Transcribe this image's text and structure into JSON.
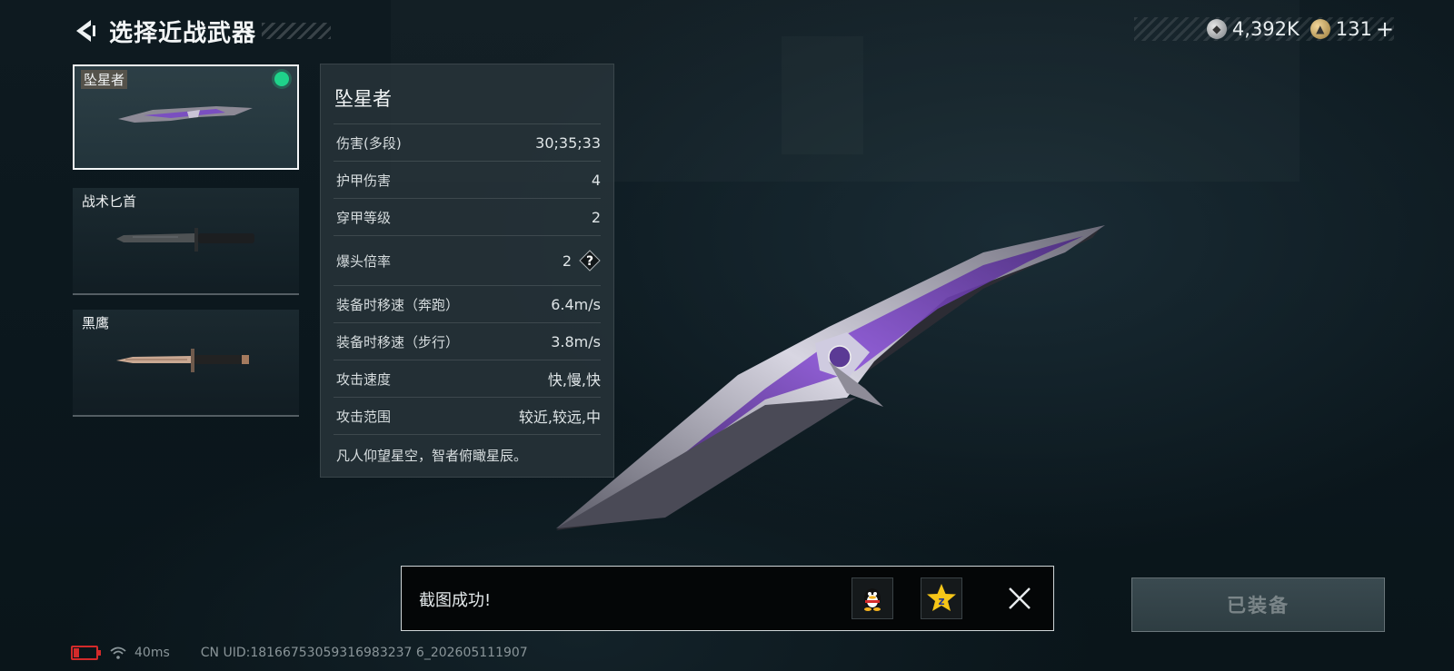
{
  "header": {
    "title": "选择近战武器"
  },
  "currency": {
    "silver": "4,392K",
    "gold": "131",
    "plus": "+"
  },
  "weapons": [
    {
      "name": "坠星者",
      "selected": true,
      "equipped": true
    },
    {
      "name": "战术匕首",
      "selected": false
    },
    {
      "name": "黑鹰",
      "selected": false
    }
  ],
  "stats": {
    "title": "坠星者",
    "rows": [
      {
        "label": "伤害(多段)",
        "value": "30;35;33"
      },
      {
        "label": "护甲伤害",
        "value": "4"
      },
      {
        "label": "穿甲等级",
        "value": "2"
      },
      {
        "label": "爆头倍率",
        "value": "2"
      },
      {
        "label": "装备时移速（奔跑）",
        "value": "6.4m/s"
      },
      {
        "label": "装备时移速（步行）",
        "value": "3.8m/s"
      },
      {
        "label": "攻击速度",
        "value": "快,慢,快"
      },
      {
        "label": "攻击范围",
        "value": "较近,较远,中"
      }
    ],
    "description": "凡人仰望星空，智者俯瞰星辰。"
  },
  "toast": {
    "text": "截图成功!"
  },
  "equip_button": {
    "label": "已装备"
  },
  "status_bar": {
    "ping": "40ms",
    "uid": "CN UID:18166753059316983237 6_202605111907"
  },
  "colors": {
    "equipped_dot": "#1fd38a",
    "battery": "#d42a2a",
    "accent_purple": "#7a3cc4"
  }
}
